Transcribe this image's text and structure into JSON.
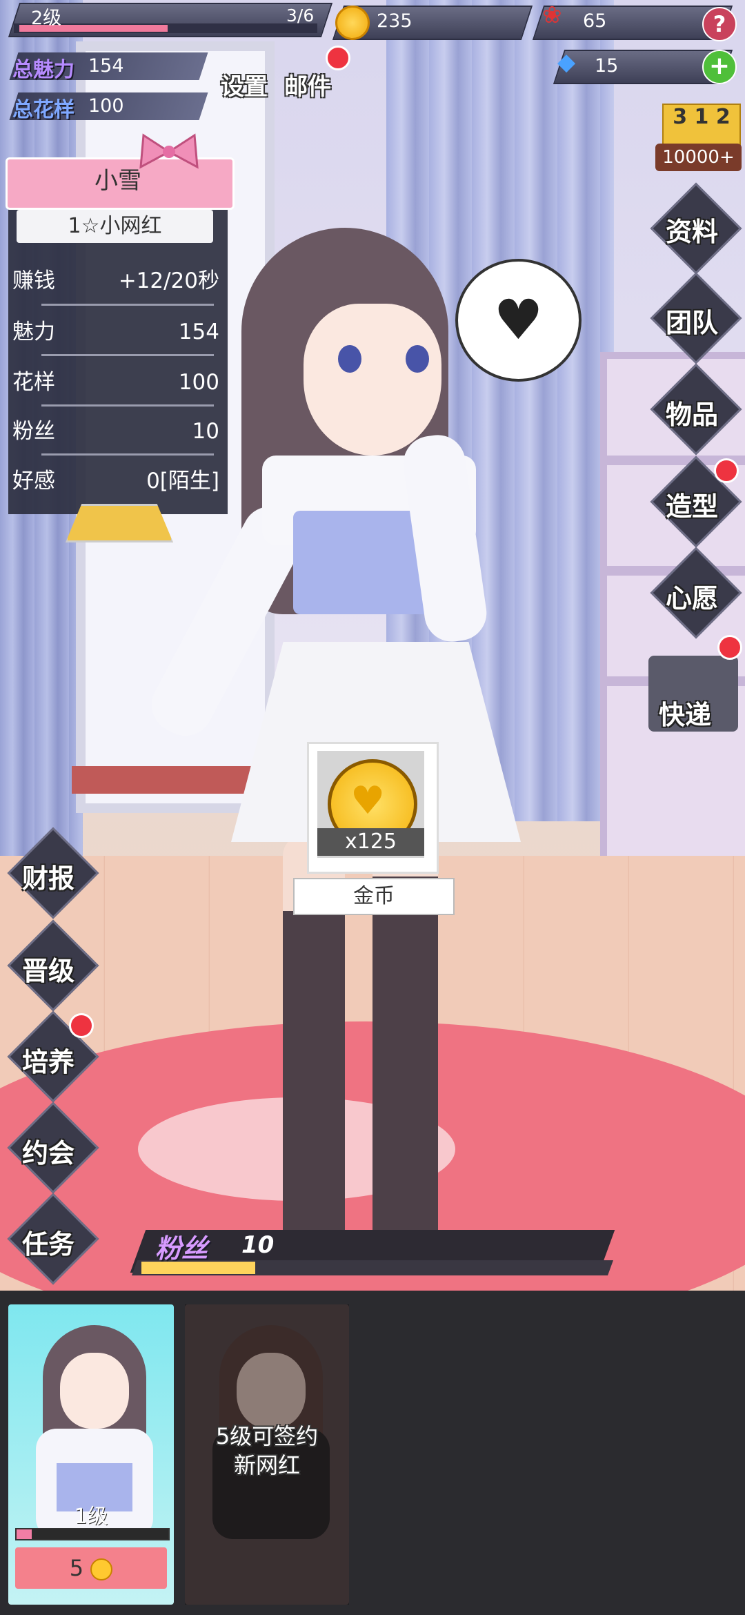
{
  "hud": {
    "level_label": "2级",
    "level_progress_text": "3/6",
    "level_progress": 0.5,
    "coins": "235",
    "roses": "65",
    "diamonds": "15",
    "help_glyph": "?",
    "plus_glyph": "+"
  },
  "totals": {
    "charm_label": "总魅力",
    "charm_value": "154",
    "style_label": "总花样",
    "style_value": "100"
  },
  "top_menu": {
    "settings": "设置",
    "mail": "邮件"
  },
  "ranking": {
    "podium": "3 1 2",
    "label": "10000+"
  },
  "character": {
    "name": "小雪",
    "title": "1☆小网红",
    "stats": [
      {
        "label": "赚钱",
        "value": "+12/20秒"
      },
      {
        "label": "魅力",
        "value": "154"
      },
      {
        "label": "花样",
        "value": "100"
      },
      {
        "label": "粉丝",
        "value": "10"
      },
      {
        "label": "好感",
        "value": "0[陌生]"
      }
    ]
  },
  "right_menu": [
    "资料",
    "团队",
    "物品",
    "造型",
    "心愿",
    "快递"
  ],
  "left_menu": [
    "财报",
    "晋级",
    "培养",
    "约会",
    "任务"
  ],
  "reward": {
    "count": "x125",
    "name": "金币"
  },
  "fans": {
    "label": "粉丝",
    "value": "10",
    "progress": 0.25
  },
  "roster": [
    {
      "level": "1级",
      "price": "5",
      "progress": 0.1
    },
    {
      "locked_text_line1": "5级可签约",
      "locked_text_line2": "新网红"
    }
  ],
  "colors": {
    "accent_pink": "#f4818c",
    "hud_dark": "#3e4057",
    "notify_red": "#ee3340",
    "coin_gold": "#f1a90a"
  },
  "icons": [
    "coin-icon",
    "rose-icon",
    "diamond-icon",
    "help-icon",
    "plus-icon",
    "bow-icon",
    "heart-speech-icon"
  ]
}
